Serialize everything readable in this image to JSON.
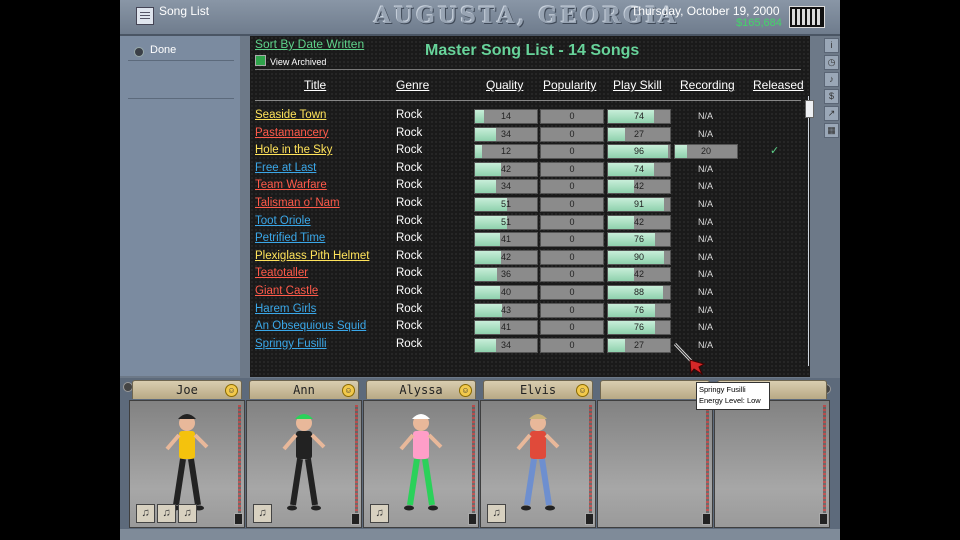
{
  "topbar": {
    "title": "Song List",
    "city": "AUGUSTA, GEORGIA",
    "date": "Thursday, October 19, 2000",
    "money": "$165,684"
  },
  "left": {
    "done_label": "Done"
  },
  "list": {
    "sort_link": "Sort By Date Written",
    "view_archived": "View Archived",
    "title": "Master Song List - 14 Songs",
    "headers": {
      "title": "Title",
      "genre": "Genre",
      "quality": "Quality",
      "popularity": "Popularity",
      "play_skill": "Play Skill",
      "recording": "Recording",
      "released": "Released"
    },
    "songs": [
      {
        "title": "Seaside Town",
        "genre": "Rock",
        "quality": 14,
        "popularity": 0,
        "play_skill": 74,
        "recording": "N/A",
        "released": "",
        "color": "#ffe35a"
      },
      {
        "title": "Pastamancery",
        "genre": "Rock",
        "quality": 34,
        "popularity": 0,
        "play_skill": 27,
        "recording": "N/A",
        "released": "",
        "color": "#ff5a4a"
      },
      {
        "title": "Hole in the Sky",
        "genre": "Rock",
        "quality": 12,
        "popularity": 0,
        "play_skill": 96,
        "recording": "20",
        "released": "✓",
        "color": "#ffe35a"
      },
      {
        "title": "Free at Last",
        "genre": "Rock",
        "quality": 42,
        "popularity": 0,
        "play_skill": 74,
        "recording": "N/A",
        "released": "",
        "color": "#3aa7e8"
      },
      {
        "title": "Team Warfare",
        "genre": "Rock",
        "quality": 34,
        "popularity": 0,
        "play_skill": 42,
        "recording": "N/A",
        "released": "",
        "color": "#ff5a4a"
      },
      {
        "title": "Talisman o' Nam",
        "genre": "Rock",
        "quality": 51,
        "popularity": 0,
        "play_skill": 91,
        "recording": "N/A",
        "released": "",
        "color": "#ff5a4a"
      },
      {
        "title": "Toot Oriole",
        "genre": "Rock",
        "quality": 51,
        "popularity": 0,
        "play_skill": 42,
        "recording": "N/A",
        "released": "",
        "color": "#3aa7e8"
      },
      {
        "title": "Petrified Time",
        "genre": "Rock",
        "quality": 41,
        "popularity": 0,
        "play_skill": 76,
        "recording": "N/A",
        "released": "",
        "color": "#3aa7e8"
      },
      {
        "title": "Plexiglass Pith Helmet",
        "genre": "Rock",
        "quality": 42,
        "popularity": 0,
        "play_skill": 90,
        "recording": "N/A",
        "released": "",
        "color": "#ffe35a"
      },
      {
        "title": "Teatotaller",
        "genre": "Rock",
        "quality": 36,
        "popularity": 0,
        "play_skill": 42,
        "recording": "N/A",
        "released": "",
        "color": "#ff5a4a"
      },
      {
        "title": "Giant Castle",
        "genre": "Rock",
        "quality": 40,
        "popularity": 0,
        "play_skill": 88,
        "recording": "N/A",
        "released": "",
        "color": "#ff5a4a"
      },
      {
        "title": "Harem Girls",
        "genre": "Rock",
        "quality": 43,
        "popularity": 0,
        "play_skill": 76,
        "recording": "N/A",
        "released": "",
        "color": "#3aa7e8"
      },
      {
        "title": "An Obsequious Squid",
        "genre": "Rock",
        "quality": 41,
        "popularity": 0,
        "play_skill": 76,
        "recording": "N/A",
        "released": "",
        "color": "#3aa7e8"
      },
      {
        "title": "Springy Fusilli",
        "genre": "Rock",
        "quality": 34,
        "popularity": 0,
        "play_skill": 27,
        "recording": "N/A",
        "released": "",
        "color": "#3aa7e8"
      }
    ]
  },
  "band": {
    "members": [
      {
        "name": "Joe",
        "shirt": "#f4c20d",
        "pants": "#222",
        "hair": "#222",
        "instruments": [
          "drums-icon",
          "cymbal-icon",
          "snare-icon"
        ]
      },
      {
        "name": "Ann",
        "shirt": "#222",
        "pants": "#222",
        "hair": "#2bd15a",
        "instruments": [
          "guitar-icon"
        ]
      },
      {
        "name": "Alyssa",
        "shirt": "#ff9ec8",
        "pants": "#2bd15a",
        "hair": "#fff",
        "instruments": [
          "keyboard-icon"
        ]
      },
      {
        "name": "Elvis",
        "shirt": "#e04a3a",
        "pants": "#6e8fcf",
        "hair": "#c9b37a",
        "instruments": [
          "drum-icon"
        ]
      },
      {
        "name": ""
      },
      {
        "name": ""
      }
    ]
  },
  "tooltip": {
    "line1": "Springy Fusilli",
    "line2": "Energy Level: Low"
  }
}
